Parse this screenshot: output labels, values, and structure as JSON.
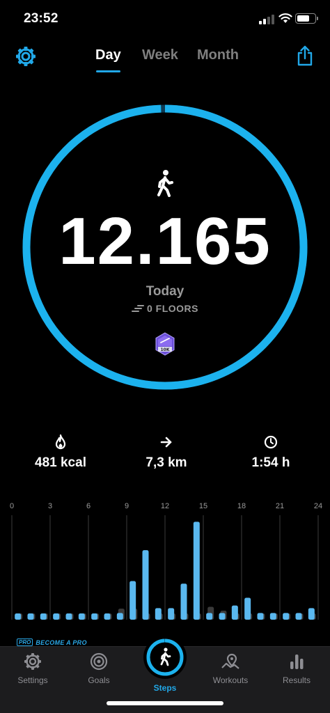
{
  "status_bar": {
    "time": "23:52"
  },
  "header": {
    "tabs": [
      {
        "label": "Day",
        "active": true
      },
      {
        "label": "Week",
        "active": false
      },
      {
        "label": "Month",
        "active": false
      }
    ],
    "icons": [
      "gear-icon",
      "share-icon"
    ]
  },
  "summary": {
    "steps": "12.165",
    "period": "Today",
    "floors": "0 FLOORS",
    "goal_progress": 0.995,
    "badge": "10K"
  },
  "stats": [
    {
      "icon": "flame-icon",
      "value": "481 kcal"
    },
    {
      "icon": "arrow-right-icon",
      "value": "7,3 km"
    },
    {
      "icon": "clock-icon",
      "value": "1:54 h"
    }
  ],
  "chart_data": {
    "type": "bar",
    "x_ticks": [
      "0",
      "3",
      "6",
      "9",
      "12",
      "15",
      "18",
      "21",
      "24"
    ],
    "bar_count": 24,
    "current": [
      130,
      90,
      90,
      90,
      90,
      90,
      90,
      110,
      260,
      1500,
      2700,
      450,
      450,
      1400,
      3800,
      260,
      260,
      550,
      850,
      260,
      260,
      260,
      260,
      450
    ],
    "comparison": [
      130,
      90,
      90,
      90,
      90,
      90,
      90,
      110,
      430,
      430,
      130,
      130,
      130,
      130,
      130,
      500,
      350,
      110,
      110,
      110,
      110,
      110,
      110,
      110
    ],
    "ylim": [
      0,
      4000
    ],
    "colors": {
      "current": "#5ab8ef",
      "comparison": "#3a3a3a"
    }
  },
  "promo": {
    "badge": "PRO",
    "text": "BECOME A PRO"
  },
  "tab_bar": {
    "items": [
      {
        "label": "Settings",
        "icon": "gear-icon"
      },
      {
        "label": "Goals",
        "icon": "target-icon"
      },
      {
        "label": "Steps",
        "icon": "walker-icon",
        "active": true
      },
      {
        "label": "Workouts",
        "icon": "map-pin-icon"
      },
      {
        "label": "Results",
        "icon": "bar-chart-icon"
      }
    ]
  },
  "colors": {
    "accent": "#21a8e8",
    "background": "#000000",
    "muted": "#7f7f7f"
  }
}
